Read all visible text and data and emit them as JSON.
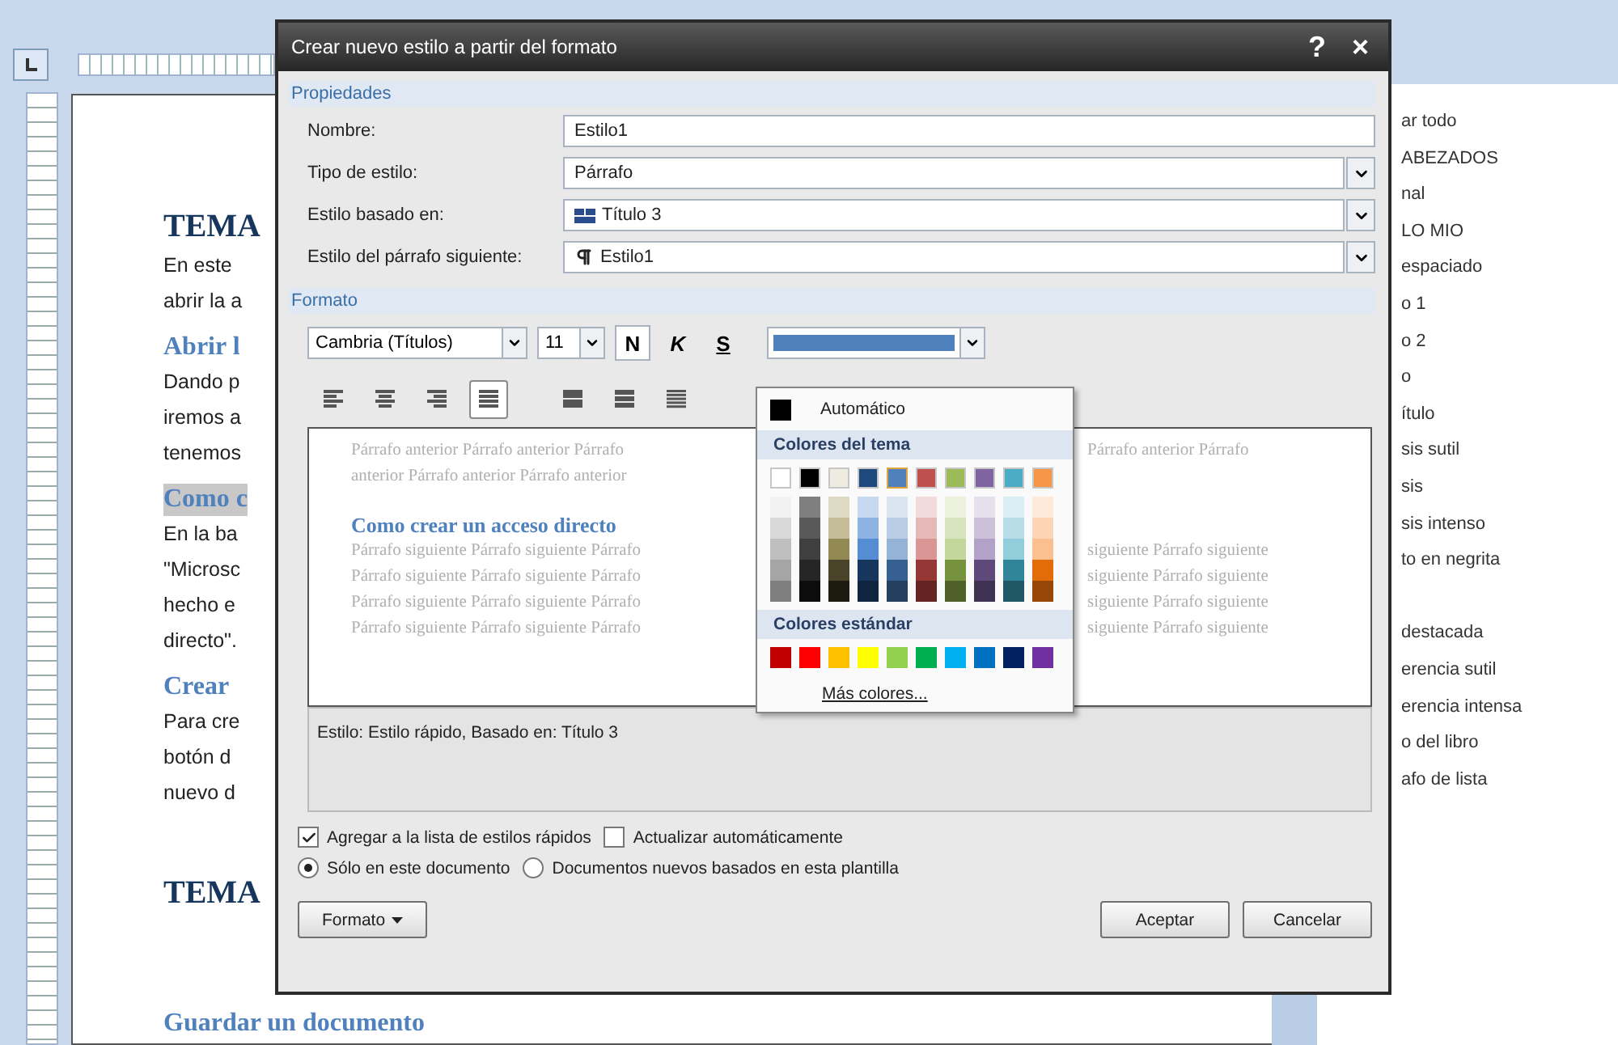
{
  "document": {
    "blocks": [
      {
        "kind": "title",
        "text": "TEMA"
      },
      {
        "kind": "para",
        "lines": [
          "En este",
          "abrir la a"
        ]
      },
      {
        "kind": "heading",
        "text": "Abrir l",
        "highlighted": false
      },
      {
        "kind": "para",
        "lines": [
          "Dando p",
          "iremos a",
          "tenemos"
        ]
      },
      {
        "kind": "heading",
        "text": "Como c",
        "highlighted": true
      },
      {
        "kind": "para",
        "lines": [
          "En la ba",
          "\"Microsc",
          "hecho e",
          "directo\"."
        ]
      },
      {
        "kind": "heading",
        "text": "Crear",
        "highlighted": false
      },
      {
        "kind": "para",
        "lines": [
          "Para cre",
          "botón d",
          "nuevo d"
        ]
      },
      {
        "kind": "title",
        "text": "TEMA"
      },
      {
        "kind": "heading",
        "text": "Guardar un documento",
        "highlighted": false
      }
    ]
  },
  "styles_pane": {
    "items": [
      {
        "kind": "style",
        "text": "ar todo"
      },
      {
        "kind": "style",
        "text": "ABEZADOS"
      },
      {
        "kind": "style",
        "text": "nal"
      },
      {
        "kind": "style",
        "text": "LO MIO"
      },
      {
        "kind": "style",
        "text": "espaciado"
      },
      {
        "kind": "style",
        "text": "o 1"
      },
      {
        "kind": "style",
        "text": "o 2"
      },
      {
        "kind": "style",
        "text": "o"
      },
      {
        "kind": "style",
        "text": "ítulo"
      },
      {
        "kind": "style",
        "text": "sis sutil"
      },
      {
        "kind": "style",
        "text": "sis"
      },
      {
        "kind": "style",
        "text": "sis intenso"
      },
      {
        "kind": "style",
        "text": "to en negrita"
      },
      {
        "kind": "gap"
      },
      {
        "kind": "style",
        "text": "destacada"
      },
      {
        "kind": "style",
        "text": "erencia sutil"
      },
      {
        "kind": "style",
        "text": "erencia intensa"
      },
      {
        "kind": "style",
        "text": "o del libro"
      },
      {
        "kind": "style",
        "text": "afo de lista"
      }
    ]
  },
  "dialog": {
    "title": "Crear nuevo estilo a partir del formato",
    "help": "?",
    "close": "×",
    "properties_label": "Propiedades",
    "fields": [
      {
        "kind": "text",
        "label": "Nombre:",
        "value": "Estilo1"
      },
      {
        "kind": "select",
        "label": "Tipo de estilo:",
        "value": "Párrafo"
      },
      {
        "kind": "heading_select",
        "label": "Estilo basado en:",
        "value": "Título 3"
      },
      {
        "kind": "paragraph_select",
        "label": "Estilo del párrafo siguiente:",
        "value": "Estilo1"
      }
    ],
    "format_label": "Formato",
    "font": "Cambria (Títulos)",
    "size": "11",
    "bold": "N",
    "italic": "K",
    "underline": "S",
    "font_color": {
      "color": "#4f81bd"
    },
    "align_buttons": [
      {
        "kind": "left",
        "selected": false
      },
      {
        "kind": "center",
        "selected": false
      },
      {
        "kind": "right",
        "selected": false
      },
      {
        "kind": "justify",
        "selected": true
      }
    ],
    "spacing_buttons": [
      {
        "kind": "single"
      },
      {
        "kind": "onehalf"
      },
      {
        "kind": "double"
      }
    ],
    "preview": {
      "before": [
        {
          "left": "Párrafo anterior Párrafo anterior Párrafo",
          "right": "Párrafo anterior Párrafo"
        },
        {
          "left": "anterior Párrafo anterior Párrafo anterior"
        }
      ],
      "heading": "Como crear un acceso directo",
      "after": [
        {
          "left": "Párrafo siguiente Párrafo siguiente Párrafo",
          "right": "siguiente Párrafo siguiente"
        },
        {
          "left": "Párrafo siguiente Párrafo siguiente Párrafo",
          "right": "siguiente Párrafo siguiente"
        },
        {
          "left": "Párrafo siguiente Párrafo siguiente Párrafo",
          "right": "siguiente Párrafo siguiente"
        },
        {
          "left": "Párrafo siguiente Párrafo siguiente Párrafo",
          "right": "siguiente Párrafo siguiente"
        }
      ]
    },
    "description": "Estilo: Estilo rápido, Basado en: Título 3",
    "checkboxes": [
      {
        "label": "Agregar a la lista de estilos rápidos",
        "checked": true
      },
      {
        "label": "Actualizar automáticamente",
        "checked": false
      }
    ],
    "radios": [
      {
        "label": "Sólo en este documento",
        "selected": true
      },
      {
        "label": "Documentos nuevos basados en esta plantilla",
        "selected": false
      }
    ],
    "format_button": "Formato",
    "ok": "Aceptar",
    "cancel": "Cancelar"
  },
  "color_menu": {
    "automatic": "Automático",
    "theme_label": "Colores del tema",
    "theme": [
      {
        "color": "#ffffff",
        "selected": false,
        "shades": [
          {
            "color": "#f2f2f2"
          },
          {
            "color": "#d8d8d8"
          },
          {
            "color": "#bfbfbf"
          },
          {
            "color": "#a5a5a5"
          },
          {
            "color": "#7f7f7f"
          }
        ]
      },
      {
        "color": "#000000",
        "selected": false,
        "shades": [
          {
            "color": "#7f7f7f"
          },
          {
            "color": "#595959"
          },
          {
            "color": "#3f3f3f"
          },
          {
            "color": "#262626"
          },
          {
            "color": "#0c0c0c"
          }
        ]
      },
      {
        "color": "#eeece1",
        "selected": false,
        "shades": [
          {
            "color": "#ddd9c3"
          },
          {
            "color": "#c4bd97"
          },
          {
            "color": "#938953"
          },
          {
            "color": "#494429"
          },
          {
            "color": "#1d1b10"
          }
        ]
      },
      {
        "color": "#1f497d",
        "selected": false,
        "shades": [
          {
            "color": "#c6d9f0"
          },
          {
            "color": "#8db3e2"
          },
          {
            "color": "#548dd4"
          },
          {
            "color": "#17365d"
          },
          {
            "color": "#0f243e"
          }
        ]
      },
      {
        "color": "#4f81bd",
        "selected": true,
        "shades": [
          {
            "color": "#dbe5f1"
          },
          {
            "color": "#b8cce4"
          },
          {
            "color": "#95b3d7"
          },
          {
            "color": "#366092"
          },
          {
            "color": "#244061"
          }
        ]
      },
      {
        "color": "#c0504d",
        "selected": false,
        "shades": [
          {
            "color": "#f2dcdb"
          },
          {
            "color": "#e5b9b7"
          },
          {
            "color": "#d99694"
          },
          {
            "color": "#953734"
          },
          {
            "color": "#632423"
          }
        ]
      },
      {
        "color": "#9bbb59",
        "selected": false,
        "shades": [
          {
            "color": "#ebf1dd"
          },
          {
            "color": "#d7e3bc"
          },
          {
            "color": "#c3d69b"
          },
          {
            "color": "#76923c"
          },
          {
            "color": "#4f6128"
          }
        ]
      },
      {
        "color": "#8064a2",
        "selected": false,
        "shades": [
          {
            "color": "#e5e0ec"
          },
          {
            "color": "#ccc1d9"
          },
          {
            "color": "#b2a2c7"
          },
          {
            "color": "#5f497a"
          },
          {
            "color": "#3f3151"
          }
        ]
      },
      {
        "color": "#4bacc6",
        "selected": false,
        "shades": [
          {
            "color": "#dbeef3"
          },
          {
            "color": "#b7dde8"
          },
          {
            "color": "#92cddc"
          },
          {
            "color": "#31859b"
          },
          {
            "color": "#205867"
          }
        ]
      },
      {
        "color": "#f79646",
        "selected": false,
        "shades": [
          {
            "color": "#fdeada"
          },
          {
            "color": "#fbd5b5"
          },
          {
            "color": "#fac08f"
          },
          {
            "color": "#e36c09"
          },
          {
            "color": "#974806"
          }
        ]
      }
    ],
    "standard_label": "Colores estándar",
    "standard": [
      {
        "color": "#c00000"
      },
      {
        "color": "#ff0000"
      },
      {
        "color": "#ffc000"
      },
      {
        "color": "#ffff00"
      },
      {
        "color": "#92d050"
      },
      {
        "color": "#00b050"
      },
      {
        "color": "#00b0f0"
      },
      {
        "color": "#0070c0"
      },
      {
        "color": "#002060"
      },
      {
        "color": "#7030a0"
      }
    ],
    "more": "Más colores..."
  }
}
